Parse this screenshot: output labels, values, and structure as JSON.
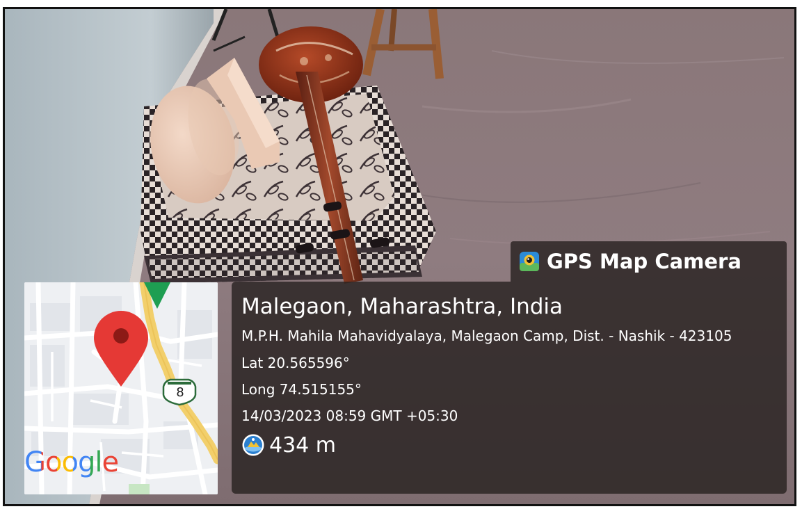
{
  "overlay": {
    "brand_name": "GPS Map Camera",
    "place": "Malegaon, Maharashtra, India",
    "address": "M.P.H. Mahila Mahavidyalaya, Malegaon Camp, Dist. - Nashik - 423105",
    "latitude": "Lat 20.565596°",
    "longitude": "Long 74.515155°",
    "datetime": "14/03/2023 08:59 GMT +05:30",
    "altitude": "434 m"
  },
  "map": {
    "watermark": "Google",
    "route_shield": "8"
  },
  "colors": {
    "overlay_bg": "#282221",
    "map_pin": "#e53935",
    "road_yellow": "#f2cf6b",
    "map_bg": "#eef0f3",
    "direction_marker": "#1e9e52"
  },
  "icons": {
    "brand": "gps-map-camera-app-icon",
    "altitude": "altitude-icon",
    "pin": "map-pin-icon",
    "direction": "direction-marker-icon"
  }
}
